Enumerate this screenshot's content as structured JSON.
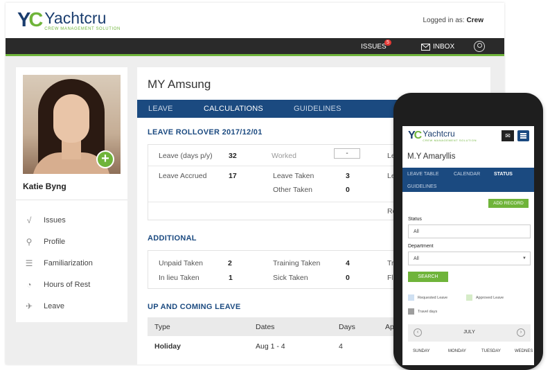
{
  "brand": {
    "mark": "YC",
    "name": "Yachtcru",
    "sub": "CREW MANAGEMENT SOLUTION",
    "accent": "#6fb43a",
    "primary": "#1b4a80"
  },
  "header": {
    "logged_in_prefix": "Logged in as:",
    "user": "Crew"
  },
  "navbar": {
    "issues": "ISSUES",
    "issues_count": "5",
    "inbox": "INBOX",
    "user_icon": "user-circle-icon"
  },
  "profile": {
    "name": "Katie Byng",
    "menu": [
      {
        "label": "Issues",
        "icon": "check-icon"
      },
      {
        "label": "Profile",
        "icon": "person-icon"
      },
      {
        "label": "Familiarization",
        "icon": "list-icon"
      },
      {
        "label": "Hours of Rest",
        "icon": "clock-icon"
      },
      {
        "label": "Leave",
        "icon": "plane-icon"
      }
    ]
  },
  "main": {
    "vessel": "MY Amsung",
    "tabs": [
      "LEAVE",
      "CALCULATIONS",
      "GUIDELINES"
    ],
    "active_tab": "CALCULATIONS",
    "rollover": {
      "title": "LEAVE ROLLOVER 2017/12/01",
      "leave_label": "Leave (days p/y)",
      "leave_value": "32",
      "worked_label": "Worked",
      "worked_value": "-",
      "accrued_label": "Leave Accrued",
      "accrued_value": "17",
      "taken_label": "Leave Taken",
      "taken_value": "3",
      "other_label": "Other Taken",
      "other_value": "0",
      "cut_1": "Le",
      "cut_2": "Le",
      "cut_3": "Re"
    },
    "additional": {
      "title": "ADDITIONAL",
      "unpaid_label": "Unpaid Taken",
      "unpaid_value": "2",
      "training_label": "Training Taken",
      "training_value": "4",
      "inlieu_label": "In lieu Taken",
      "inlieu_value": "1",
      "sick_label": "Sick Taken",
      "sick_value": "0",
      "cut_1": "Tr",
      "cut_2": "Fl"
    },
    "upcoming": {
      "title": "UP AND COMING LEAVE",
      "columns": [
        "Type",
        "Dates",
        "Days",
        "Ap"
      ],
      "rows": [
        {
          "type": "Holiday",
          "dates": "Aug 1 - 4",
          "days": "4"
        }
      ]
    }
  },
  "mobile": {
    "vessel": "M.Y Amaryllis",
    "tabs": [
      "LEAVE TABLE",
      "CALENDAR",
      "STATUS",
      "GUIDELINES"
    ],
    "active_tab": "STATUS",
    "add_record": "ADD RECORD",
    "status_label": "Status",
    "status_value": "All",
    "department_label": "Department",
    "department_value": "All",
    "search": "SEARCH",
    "legend": [
      {
        "label": "Requested Leave",
        "color": "#cfe0f2"
      },
      {
        "label": "Approved Leave",
        "color": "#d6ecc8"
      },
      {
        "label": "Travel days",
        "color": "#9e9e9e"
      }
    ],
    "calendar": {
      "month": "JULY",
      "days": [
        "SUNDAY",
        "MONDAY",
        "TUESDAY",
        "WEDNES"
      ]
    }
  }
}
